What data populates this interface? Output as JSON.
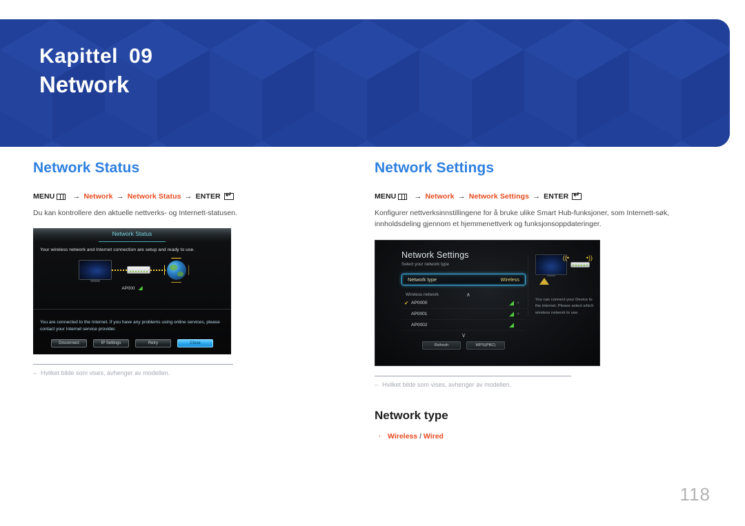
{
  "header": {
    "chapter_label": "Kapittel",
    "chapter_number": "09",
    "chapter_title": "Network",
    "banner_color": "#21409a"
  },
  "left_column": {
    "section_title": "Network Status",
    "menu_path": {
      "menu_label": "MENU",
      "menu_icon": "menu-grid-icon",
      "arrow": "→",
      "step1": "Network",
      "step2": "Network Status",
      "enter_label": "ENTER",
      "enter_icon": "enter-return-icon"
    },
    "description": "Du kan kontrollere den aktuelle nettverks- og Internett-statusen.",
    "footnote": {
      "dash": "–",
      "text": "Hvilket bilde som vises, avhenger av modellen."
    },
    "tv_dialog": {
      "title": "Network Status",
      "message": "Your wireless network and Internet connection are setup and ready to use.",
      "ap_label": "AP000",
      "wifi_icon": "wifi-signal-icon",
      "note": "You are connected to the Internet. If you have any problems using online services, please contact your Internet service provider.",
      "buttons": [
        "Disconnect",
        "IP Settings",
        "Retry",
        "Close"
      ],
      "primary_button": "Close",
      "title_color": "#79d7e6",
      "primary_color": "#28a6ee"
    }
  },
  "right_column": {
    "section_title": "Network Settings",
    "menu_path": {
      "menu_label": "MENU",
      "menu_icon": "menu-grid-icon",
      "arrow": "→",
      "step1": "Network",
      "step2": "Network Settings",
      "enter_label": "ENTER",
      "enter_icon": "enter-return-icon"
    },
    "description": "Konfigurer nettverksinnstillingene for å bruke ulike Smart Hub-funksjoner, som Internett-søk, innholdsdeling gjennom et hjemmenettverk og funksjonsoppdateringer.",
    "footnote": {
      "dash": "–",
      "text": "Hvilket bilde som vises, avhenger av modellen."
    },
    "tv_dialog": {
      "title": "Network Settings",
      "subtitle": "Select your network type",
      "type_row_key": "Network type",
      "type_row_value": "Wireless",
      "list_header": "Wireless network",
      "up_chevron": "∧",
      "down_chevron": "∨",
      "access_points": [
        {
          "name": "AP0000",
          "selected": true,
          "has_arrow": true
        },
        {
          "name": "AP0001",
          "selected": false,
          "has_arrow": true
        },
        {
          "name": "AP0002",
          "selected": false,
          "has_arrow": false
        }
      ],
      "check_glyph": "✔",
      "arrow_glyph": "›",
      "wifi_icon": "wifi-signal-icon",
      "buttons": [
        "Refresh",
        "WPS(PBC)"
      ],
      "side_description": "You can connect your Device to the internet. Please select which wireless network to use.",
      "highlight_color": "#3fb6e8"
    },
    "sub_section": {
      "title": "Network type",
      "bullet_glyph": "·",
      "option_1": "Wireless",
      "separator": "/",
      "option_2": "Wired"
    }
  },
  "page_number": "118"
}
